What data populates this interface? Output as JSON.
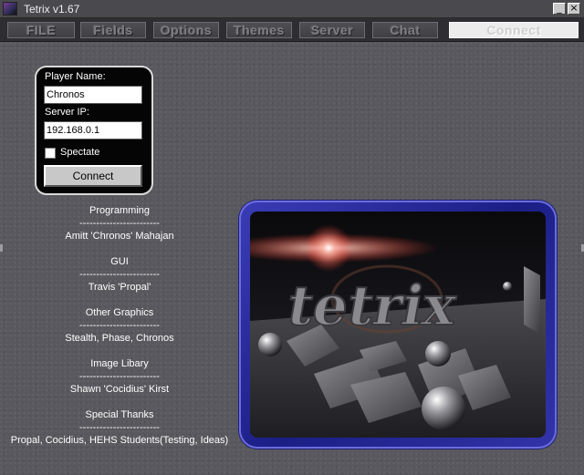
{
  "window": {
    "title": "Tetrix v1.67"
  },
  "tabs": [
    {
      "label": "FILE"
    },
    {
      "label": "Fields"
    },
    {
      "label": "Options"
    },
    {
      "label": "Themes"
    },
    {
      "label": "Server"
    },
    {
      "label": "Chat"
    },
    {
      "label": "Connect",
      "active": true
    }
  ],
  "connect_form": {
    "player_name_label": "Player Name:",
    "player_name_value": "Chronos",
    "server_ip_label": "Server IP:",
    "server_ip_value": "192.168.0.1",
    "spectate_label": "Spectate",
    "spectate_checked": false,
    "connect_button_label": "Connect"
  },
  "credits": [
    {
      "heading": "Programming",
      "divider": "------------------------",
      "names": "Amitt 'Chronos' Mahajan"
    },
    {
      "heading": "GUI",
      "divider": "------------------------",
      "names": "Travis 'Propal'"
    },
    {
      "heading": "Other Graphics",
      "divider": "------------------------",
      "names": "Stealth, Phase, Chronos"
    },
    {
      "heading": "Image Libary",
      "divider": "------------------------",
      "names": "Shawn 'Cocidius' Kirst"
    },
    {
      "heading": "Special Thanks",
      "divider": "------------------------",
      "names": "Propal, Cocidius, HEHS Students(Testing, Ideas)"
    }
  ],
  "splash": {
    "logo_text": "tetrix"
  },
  "colors": {
    "frame_blue": "#2a2ca4",
    "panel_bg": "#050505",
    "background": "#58585e"
  }
}
